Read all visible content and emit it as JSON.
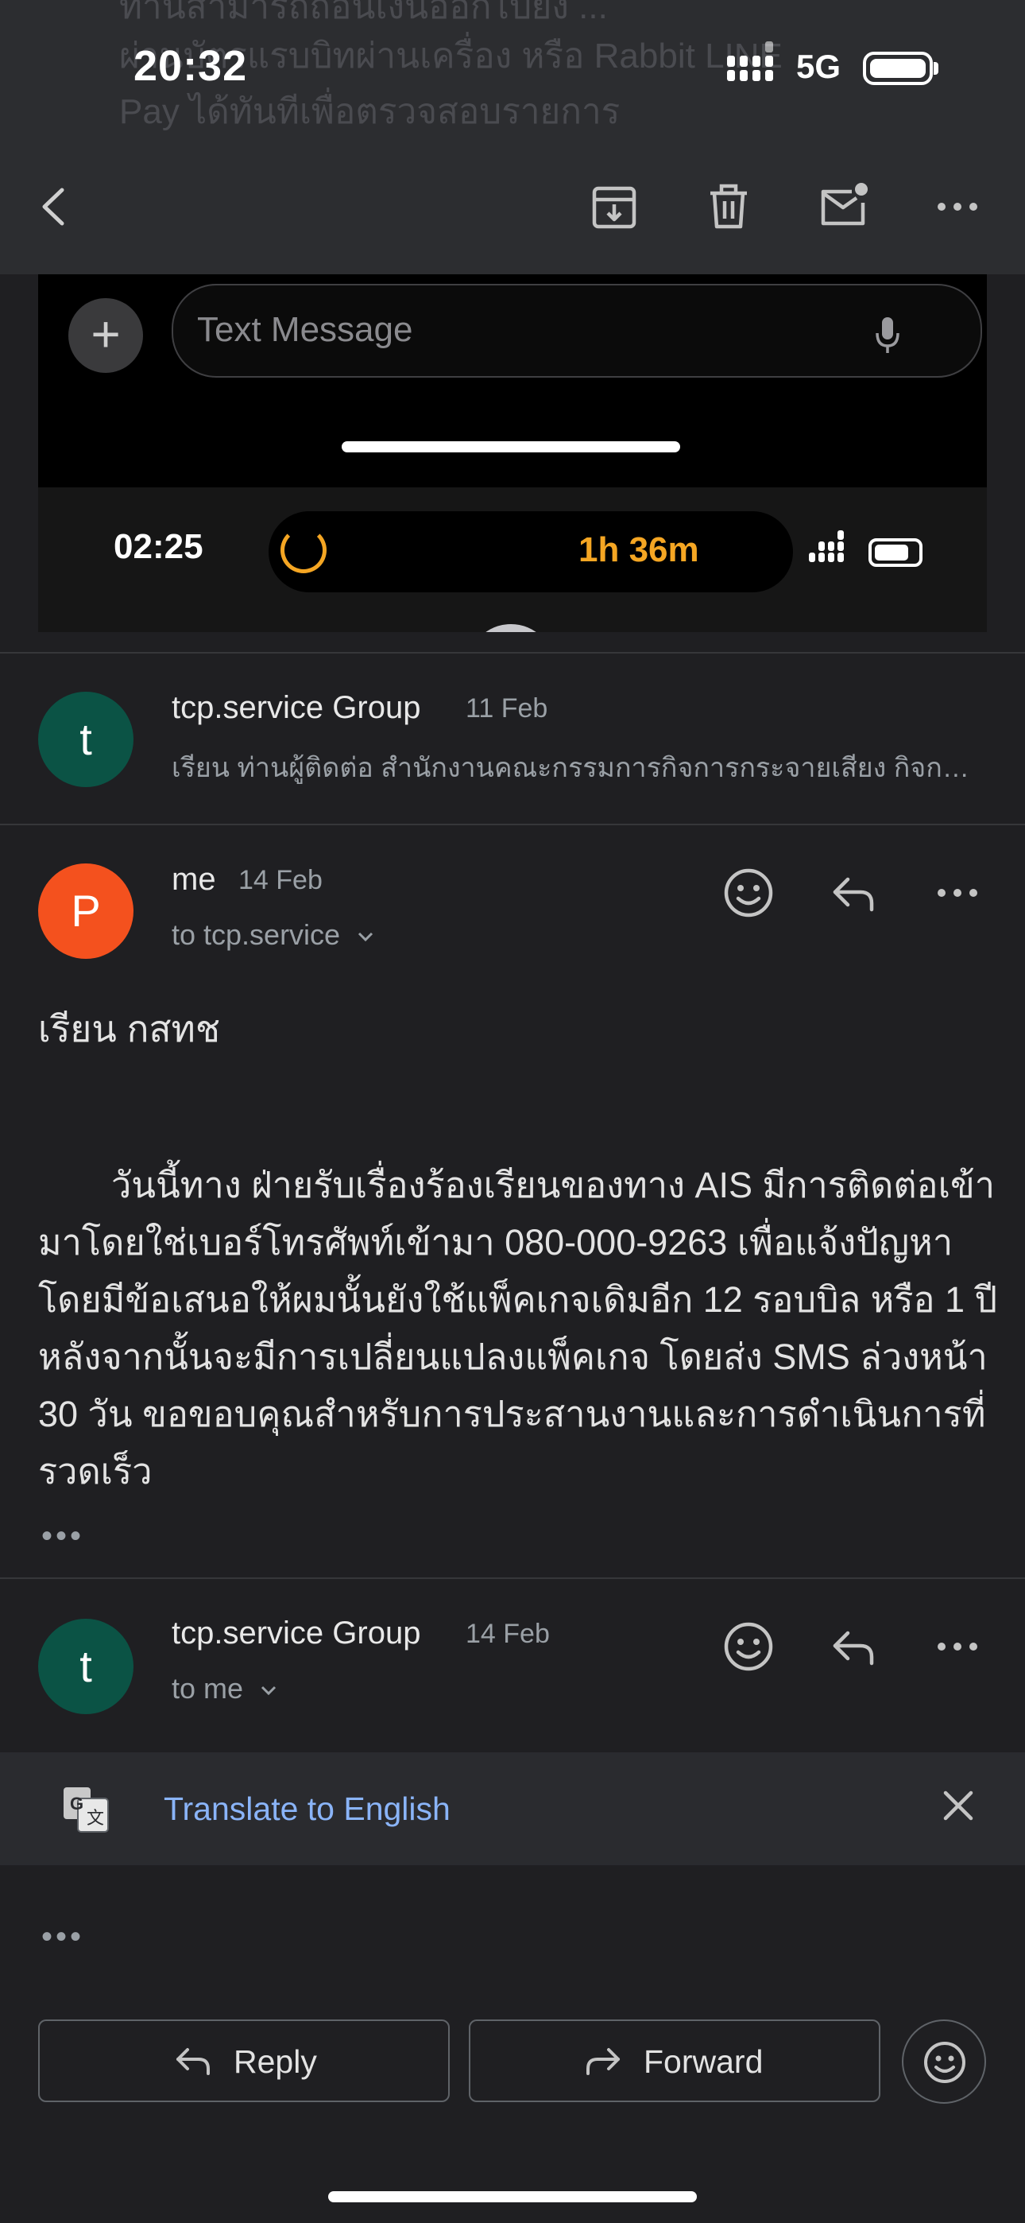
{
  "status_bar": {
    "time": "20:32",
    "network": "5G"
  },
  "background_text": {
    "line1": "ท่านสามารถถอนเงินออกไปยัง ...",
    "line2": "ผ่านบัตรแรบบิทผ่านเครื่อง หรือ Rabbit LINE",
    "line3": "Pay ได้ทันทีเพื่อตรวจสอบรายการ"
  },
  "toolbar": {
    "back": "back-icon",
    "archive": "archive-icon",
    "delete": "trash-icon",
    "mark_unread": "mail-unread-icon",
    "more": "more-horizontal-icon"
  },
  "embedded_screenshot": {
    "input_placeholder": "Text Message",
    "time": "02:25",
    "timer": "1h 36m"
  },
  "threads": [
    {
      "avatar_letter": "t",
      "avatar_color": "#0b5345",
      "sender": "tcp.service Group",
      "date": "11 Feb",
      "snippet": "เรียน ท่านผู้ติดต่อ สำนักงานคณะกรรมการกิจการกระจายเสียง กิจการโทรทัศน์"
    },
    {
      "avatar_letter": "P",
      "avatar_color": "#f4511e",
      "sender": "me",
      "date": "14 Feb",
      "recipient": "to tcp.service",
      "salutation": "เรียน กสทช",
      "body": "วันนี้ทาง ฝ่ายรับเรื่องร้องเรียนของทาง AIS มีการติดต่อเข้ามาโดยใช่เบอร์โทรศัพท์เข้ามา 080-000-9263 เพื่อแจ้งปัญหา โดยมีข้อเสนอให้ผมนั้นยังใช้แพ็คเกจเดิมอีก 12 รอบบิล หรือ 1 ปี หลังจากนั้นจะมีการเปลี่ยนแปลงแพ็คเกจ โดยส่ง SMS ล่วงหน้า 30 วัน ขอขอบคุณสำหรับการประสานงานและการดำเนินการที่รวดเร็ว",
      "collapsed_marker": "•••"
    },
    {
      "avatar_letter": "t",
      "avatar_color": "#0b5345",
      "sender": "tcp.service Group",
      "date": "14 Feb",
      "recipient": "to me",
      "collapsed_marker": "•••"
    }
  ],
  "translate_bar": {
    "link": "Translate to English"
  },
  "bottom_actions": {
    "reply": "Reply",
    "forward": "Forward"
  },
  "colors": {
    "background": "#1f1f22",
    "toolbar": "#2c2d30",
    "link": "#8ab4f8"
  }
}
